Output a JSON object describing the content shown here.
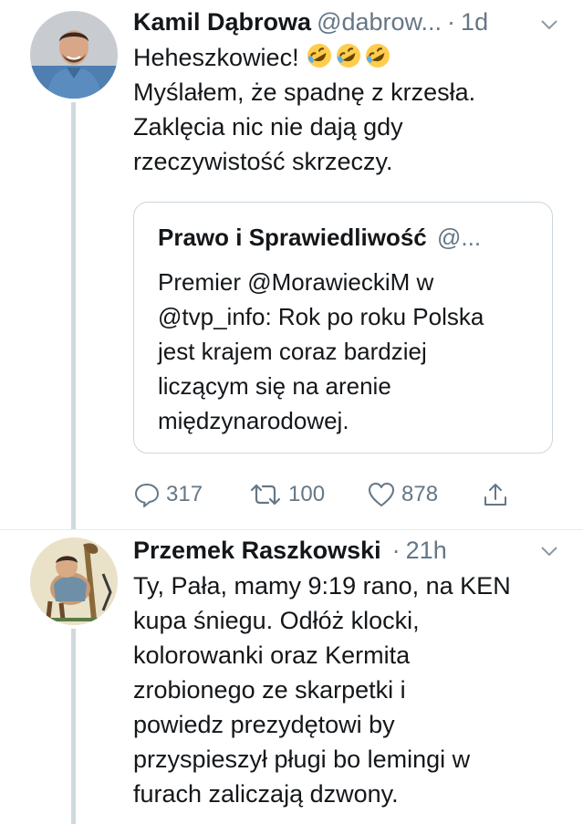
{
  "tweets": [
    {
      "name": "Kamil Dąbrowa",
      "handle": "@dabrow...",
      "dot": "·",
      "time": "1d",
      "text_first": "Heheszkowiec! ",
      "emoji": [
        "rolling-on-floor-laughing",
        "rolling-on-floor-laughing",
        "rolling-on-floor-laughing"
      ],
      "text_rest": "Myślałem, że spadnę z krzesła.\nZaklęcia nic nie dają gdy\nrzeczywistość skrzeczy.",
      "quote": {
        "name": "Prawo i Sprawiedliwość",
        "handle": "@...",
        "text": "Premier @MorawieckiM w\n@tvp_info: Rok po roku Polska\njest krajem coraz bardziej\nliczącym się na arenie\nmiędzynarodowej."
      },
      "actions": {
        "replies": "317",
        "retweets": "100",
        "likes": "878"
      }
    },
    {
      "name": "Przemek Raszkowski",
      "dot": "·",
      "time": "21h",
      "text": "Ty, Pała, mamy 9:19 rano, na KEN\nkupa śniegu. Odłóż klocki,\nkolorowanki oraz Kermita\nzrobionego ze skarpetki i\npowiedz prezydętowi by\nprzyspieszył pługi bo lemingi w\nfurach zaliczają dzwony."
    }
  ],
  "colors": {
    "text": "#14171a",
    "secondary": "#657786",
    "border": "#ccd6dd",
    "thread_line": "#cfd9de"
  }
}
